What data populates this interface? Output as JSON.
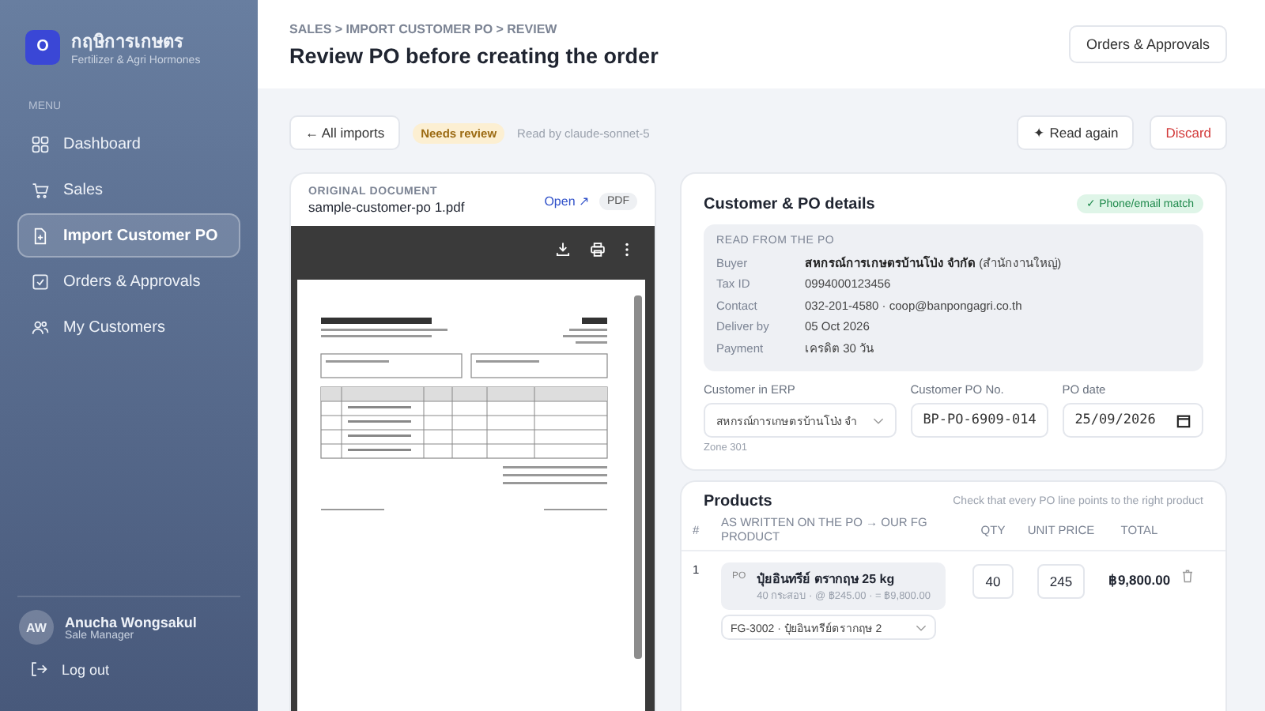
{
  "sidebar": {
    "brand": {
      "initial": "O",
      "name": "กฤษิการเกษตร",
      "tagline": "Fertilizer & Agri Hormones"
    },
    "section_label": "MENU",
    "items": [
      {
        "label": "Dashboard",
        "selected": false
      },
      {
        "label": "Sales",
        "selected": false
      },
      {
        "label": "Import Customer PO",
        "selected": true
      },
      {
        "label": "Orders & Approvals",
        "selected": false
      },
      {
        "label": "My Customers",
        "selected": false
      }
    ],
    "user": {
      "initials": "AW",
      "name": "Anucha Wongsakul",
      "role": "Sale Manager"
    },
    "logout": "Log out"
  },
  "header": {
    "breadcrumb": "SALES > IMPORT CUSTOMER PO > REVIEW",
    "title": "Review PO before creating the order",
    "action": "Orders & Approvals"
  },
  "toolbar": {
    "back": "← All imports",
    "status": "Needs review",
    "reader": "Read by claude-sonnet-5",
    "read_again": "✦ Read again",
    "discard": "Discard"
  },
  "document": {
    "label": "ORIGINAL DOCUMENT",
    "filename": "sample-customer-po 1.pdf",
    "open": "Open ↗",
    "type": "PDF"
  },
  "details": {
    "title": "Customer & PO details",
    "match": "✓ Phone/email match",
    "read_label": "READ FROM THE PO",
    "fields": [
      {
        "label": "Buyer",
        "value": "**สหกรณ์การเกษตรบ้านโป่ง จำกัด** (สำนักงานใหญ่)"
      },
      {
        "label": "Tax ID",
        "value": "0994000123456"
      },
      {
        "label": "Contact",
        "value": "032-201-4580 · coop@banpongagri.co.th"
      },
      {
        "label": "Deliver by",
        "value": "05 Oct 2026"
      },
      {
        "label": "Payment",
        "value": "เครดิต 30 วัน"
      }
    ],
    "customer": {
      "label": "Customer in ERP",
      "value": "สหกรณ์การเกษตรบ้านโป่ง จำ",
      "hint": "Zone 301"
    },
    "po_no": {
      "label": "Customer PO No.",
      "value": "BP-PO-6909-014"
    },
    "po_date": {
      "label": "PO date",
      "value": "25/09/2026"
    }
  },
  "products": {
    "title": "Products",
    "hint": "Check that every PO line points to the right product",
    "columns": [
      "#",
      "AS WRITTEN ON THE PO → OUR FG PRODUCT",
      "QTY",
      "UNIT PRICE",
      "TOTAL"
    ],
    "rows": [
      {
        "no": "1",
        "tag": "PO",
        "name": "ปุ๋ยอินทรีย์ ตรากฤษ 25 kg",
        "detail": "40 กระสอบ · @ ฿245.00 · = ฿9,800.00",
        "qty": "40",
        "price": "245",
        "total": "฿9,800.00",
        "product": "FG-3002 · ปุ๋ยอินทรีย์ตรากฤษ 2"
      }
    ]
  }
}
